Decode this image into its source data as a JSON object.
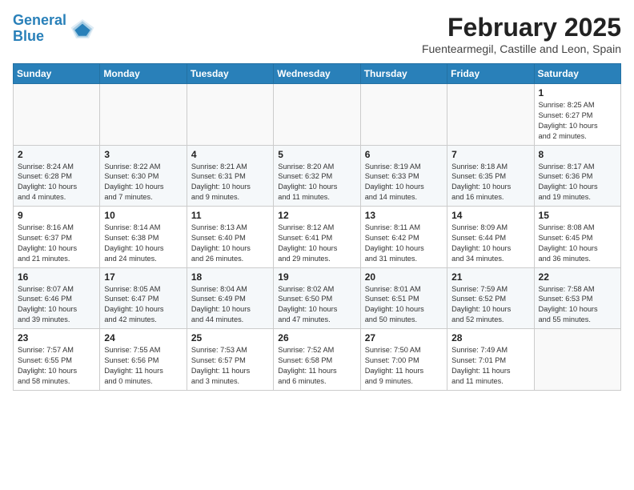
{
  "header": {
    "logo_line1": "General",
    "logo_line2": "Blue",
    "month_title": "February 2025",
    "location": "Fuentearmegil, Castille and Leon, Spain"
  },
  "weekdays": [
    "Sunday",
    "Monday",
    "Tuesday",
    "Wednesday",
    "Thursday",
    "Friday",
    "Saturday"
  ],
  "weeks": [
    [
      {
        "day": "",
        "info": ""
      },
      {
        "day": "",
        "info": ""
      },
      {
        "day": "",
        "info": ""
      },
      {
        "day": "",
        "info": ""
      },
      {
        "day": "",
        "info": ""
      },
      {
        "day": "",
        "info": ""
      },
      {
        "day": "1",
        "info": "Sunrise: 8:25 AM\nSunset: 6:27 PM\nDaylight: 10 hours\nand 2 minutes."
      }
    ],
    [
      {
        "day": "2",
        "info": "Sunrise: 8:24 AM\nSunset: 6:28 PM\nDaylight: 10 hours\nand 4 minutes."
      },
      {
        "day": "3",
        "info": "Sunrise: 8:22 AM\nSunset: 6:30 PM\nDaylight: 10 hours\nand 7 minutes."
      },
      {
        "day": "4",
        "info": "Sunrise: 8:21 AM\nSunset: 6:31 PM\nDaylight: 10 hours\nand 9 minutes."
      },
      {
        "day": "5",
        "info": "Sunrise: 8:20 AM\nSunset: 6:32 PM\nDaylight: 10 hours\nand 11 minutes."
      },
      {
        "day": "6",
        "info": "Sunrise: 8:19 AM\nSunset: 6:33 PM\nDaylight: 10 hours\nand 14 minutes."
      },
      {
        "day": "7",
        "info": "Sunrise: 8:18 AM\nSunset: 6:35 PM\nDaylight: 10 hours\nand 16 minutes."
      },
      {
        "day": "8",
        "info": "Sunrise: 8:17 AM\nSunset: 6:36 PM\nDaylight: 10 hours\nand 19 minutes."
      }
    ],
    [
      {
        "day": "9",
        "info": "Sunrise: 8:16 AM\nSunset: 6:37 PM\nDaylight: 10 hours\nand 21 minutes."
      },
      {
        "day": "10",
        "info": "Sunrise: 8:14 AM\nSunset: 6:38 PM\nDaylight: 10 hours\nand 24 minutes."
      },
      {
        "day": "11",
        "info": "Sunrise: 8:13 AM\nSunset: 6:40 PM\nDaylight: 10 hours\nand 26 minutes."
      },
      {
        "day": "12",
        "info": "Sunrise: 8:12 AM\nSunset: 6:41 PM\nDaylight: 10 hours\nand 29 minutes."
      },
      {
        "day": "13",
        "info": "Sunrise: 8:11 AM\nSunset: 6:42 PM\nDaylight: 10 hours\nand 31 minutes."
      },
      {
        "day": "14",
        "info": "Sunrise: 8:09 AM\nSunset: 6:44 PM\nDaylight: 10 hours\nand 34 minutes."
      },
      {
        "day": "15",
        "info": "Sunrise: 8:08 AM\nSunset: 6:45 PM\nDaylight: 10 hours\nand 36 minutes."
      }
    ],
    [
      {
        "day": "16",
        "info": "Sunrise: 8:07 AM\nSunset: 6:46 PM\nDaylight: 10 hours\nand 39 minutes."
      },
      {
        "day": "17",
        "info": "Sunrise: 8:05 AM\nSunset: 6:47 PM\nDaylight: 10 hours\nand 42 minutes."
      },
      {
        "day": "18",
        "info": "Sunrise: 8:04 AM\nSunset: 6:49 PM\nDaylight: 10 hours\nand 44 minutes."
      },
      {
        "day": "19",
        "info": "Sunrise: 8:02 AM\nSunset: 6:50 PM\nDaylight: 10 hours\nand 47 minutes."
      },
      {
        "day": "20",
        "info": "Sunrise: 8:01 AM\nSunset: 6:51 PM\nDaylight: 10 hours\nand 50 minutes."
      },
      {
        "day": "21",
        "info": "Sunrise: 7:59 AM\nSunset: 6:52 PM\nDaylight: 10 hours\nand 52 minutes."
      },
      {
        "day": "22",
        "info": "Sunrise: 7:58 AM\nSunset: 6:53 PM\nDaylight: 10 hours\nand 55 minutes."
      }
    ],
    [
      {
        "day": "23",
        "info": "Sunrise: 7:57 AM\nSunset: 6:55 PM\nDaylight: 10 hours\nand 58 minutes."
      },
      {
        "day": "24",
        "info": "Sunrise: 7:55 AM\nSunset: 6:56 PM\nDaylight: 11 hours\nand 0 minutes."
      },
      {
        "day": "25",
        "info": "Sunrise: 7:53 AM\nSunset: 6:57 PM\nDaylight: 11 hours\nand 3 minutes."
      },
      {
        "day": "26",
        "info": "Sunrise: 7:52 AM\nSunset: 6:58 PM\nDaylight: 11 hours\nand 6 minutes."
      },
      {
        "day": "27",
        "info": "Sunrise: 7:50 AM\nSunset: 7:00 PM\nDaylight: 11 hours\nand 9 minutes."
      },
      {
        "day": "28",
        "info": "Sunrise: 7:49 AM\nSunset: 7:01 PM\nDaylight: 11 hours\nand 11 minutes."
      },
      {
        "day": "",
        "info": ""
      }
    ]
  ]
}
